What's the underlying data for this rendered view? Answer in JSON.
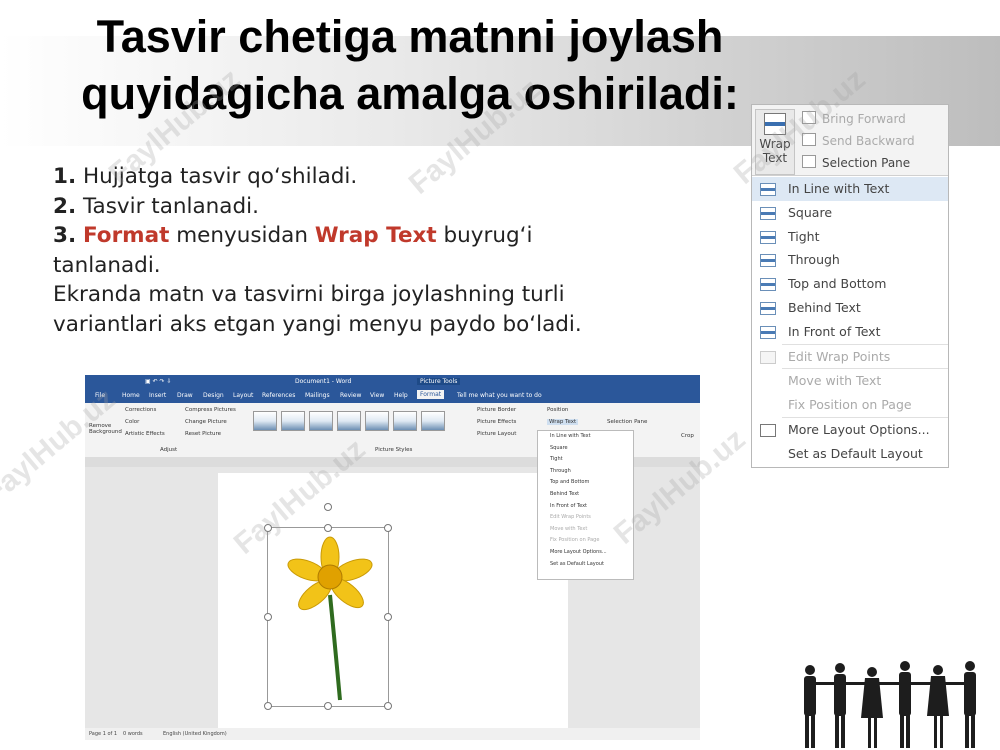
{
  "title": {
    "line1": "Tasvir chetiga matnni joylash",
    "line2": "quyidagicha amalga oshiriladi:"
  },
  "steps": {
    "s1_num": "1.",
    "s1_text": " Hujjatga tasvir qo‘shiladi.",
    "s2_num": "2.",
    "s2_text": " Tasvir tanlanadi.",
    "s3_num": "3.",
    "s3_format": "Format",
    "s3_mid": " menyusidan ",
    "s3_wrap": "Wrap Text",
    "s3_end": " buyrug‘i tanlanadi.",
    "paragraph": "Ekranda matn va tasvirni birga joylashning turli variantlari aks etgan yangi menyu paydo bo‘ladi."
  },
  "watermark": "FaylHub.uz",
  "word": {
    "window_title": "Document1 - Word",
    "context_tab": "Picture Tools",
    "tell_me": "Tell me what you want to do",
    "tabs": [
      "File",
      "Home",
      "Insert",
      "Draw",
      "Design",
      "Layout",
      "References",
      "Mailings",
      "Review",
      "View",
      "Help",
      "Format"
    ],
    "ribbon": {
      "remove_bg": "Remove Background",
      "corrections": "Corrections",
      "color": "Color",
      "artistic": "Artistic Effects",
      "compress": "Compress Pictures",
      "change": "Change Picture",
      "reset": "Reset Picture",
      "adjust": "Adjust",
      "picture_styles": "Picture Styles",
      "border": "Picture Border",
      "effects": "Picture Effects",
      "layout": "Picture Layout",
      "position": "Position",
      "wrap_text": "Wrap Text",
      "selection_pane": "Selection Pane",
      "crop": "Crop"
    },
    "status": {
      "page": "Page 1 of 1",
      "words": "0 words",
      "lang": "English (United Kingdom)"
    }
  },
  "menu": {
    "wrap_label1": "Wrap",
    "wrap_label2": "Text",
    "bring_forward": "Bring Forward",
    "send_backward": "Send Backward",
    "selection_pane": "Selection Pane",
    "items": [
      "In Line with Text",
      "Square",
      "Tight",
      "Through",
      "Top and Bottom",
      "Behind Text",
      "In Front of Text",
      "Edit Wrap Points",
      "Move with Text",
      "Fix Position on Page",
      "More Layout Options...",
      "Set as Default Layout"
    ]
  }
}
